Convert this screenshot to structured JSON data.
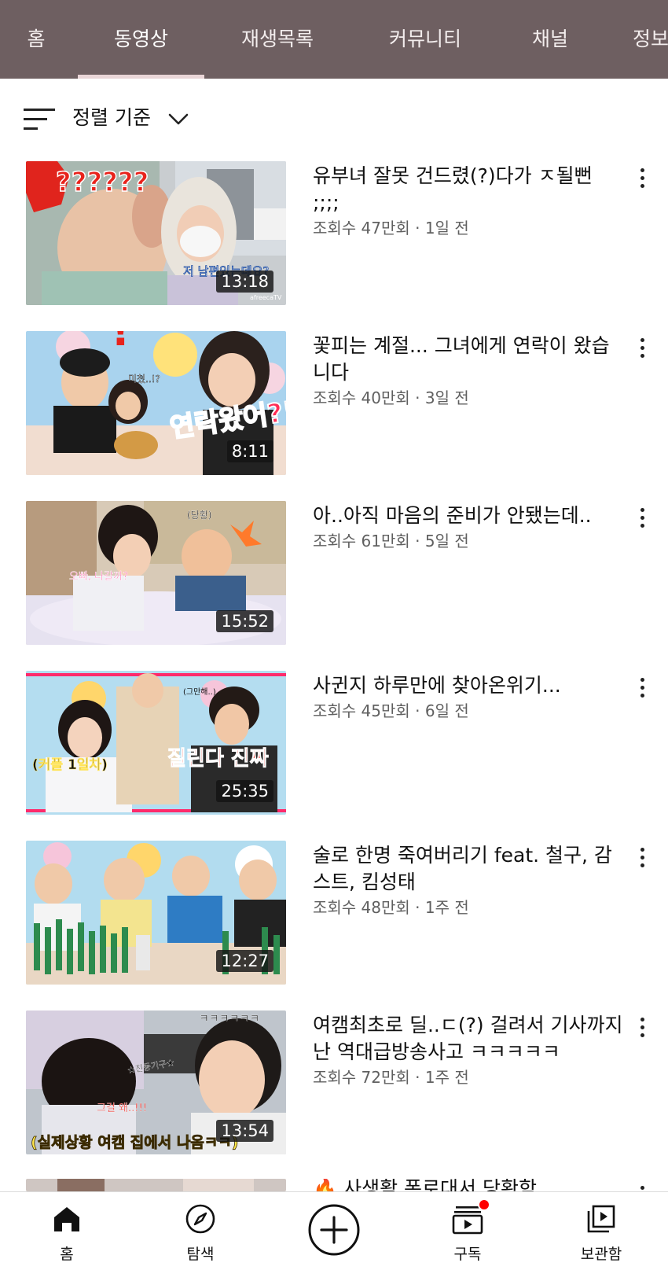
{
  "tabs": [
    {
      "label": "홈"
    },
    {
      "label": "동영상"
    },
    {
      "label": "재생목록"
    },
    {
      "label": "커뮤니티"
    },
    {
      "label": "채널"
    },
    {
      "label": "정보"
    }
  ],
  "active_tab": "동영상",
  "sort": {
    "label": "정렬 기준"
  },
  "videos": [
    {
      "title": "유부녀 잘못 건드렸(?)다가 ㅈ될뻔 ;;;;",
      "meta": "조회수 47만회 · 1일 전",
      "duration": "13:18",
      "thumb_caption": "??????",
      "thumb_caption2": "저 남편있는데요?",
      "watermark": "afreecaTV"
    },
    {
      "title": "꽃피는 계절... 그녀에게 연락이 왔습니다",
      "meta": "조회수 40만회 · 3일 전",
      "duration": "8:11",
      "thumb_caption": "연락왔어?!",
      "thumb_caption2": "미쳤..!?"
    },
    {
      "title": "아..아직 마음의 준비가 안됐는데..",
      "meta": "조회수 61만회 · 5일 전",
      "duration": "15:52",
      "thumb_caption": "오빠, 나갈까?",
      "thumb_caption2": "(당황)"
    },
    {
      "title": "사귄지 하루만에 찾아온위기...",
      "meta": "조회수 45만회 · 6일 전",
      "duration": "25:35",
      "thumb_caption": "질린다 진짜",
      "thumb_caption2": "(커플 1일차)",
      "thumb_caption3": "(그만해..)"
    },
    {
      "title": "술로 한명 죽여버리기 feat. 철구, 감스트, 킴성태",
      "meta": "조회수 48만회 · 1주 전",
      "duration": "12:27"
    },
    {
      "title": "여캠최초로 딜..ㄷ(?) 걸려서 기사까지난 역대급방송사고 ㅋㅋㅋㅋㅋ",
      "meta": "조회수 72만회 · 1주 전",
      "duration": "13:54",
      "thumb_caption": "(실제상황 여캠 집에서 나옴ㅋㅋ)",
      "thumb_caption2": "ㅋㅋㅋㅋㅋㅋ",
      "thumb_caption3": "그걸 왜..!!!",
      "thumb_caption4": "★진동기구★"
    },
    {
      "title": "🔥 사생활 폭로대서 당황함"
    }
  ],
  "bottom_nav": [
    {
      "label": "홈",
      "icon": "home-icon"
    },
    {
      "label": "탐색",
      "icon": "compass-icon"
    },
    {
      "label": "",
      "icon": "create-icon"
    },
    {
      "label": "구독",
      "icon": "subscriptions-icon"
    },
    {
      "label": "보관함",
      "icon": "library-icon"
    }
  ],
  "colors": {
    "header_bg": "#6e5f61",
    "notification_dot": "#ff0000",
    "meta_text": "#606060"
  }
}
